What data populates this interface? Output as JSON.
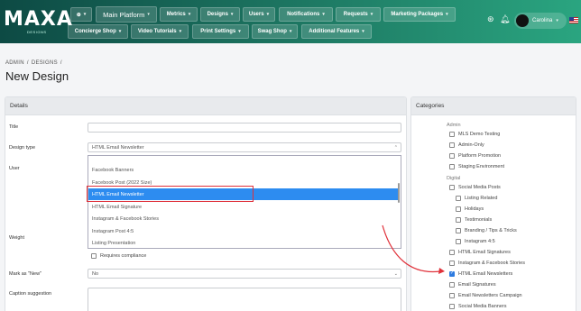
{
  "logo": {
    "text": "MAXA",
    "sub": "DESIGNS"
  },
  "nav_row1": [
    "Main Platform",
    "Metrics",
    "Designs",
    "Users",
    "Notifications",
    "Requests",
    "Marketing Packages"
  ],
  "nav_row2": [
    "Concierge Shop",
    "Video Tutorials",
    "Print Settings",
    "Swag Shop",
    "Additional Features"
  ],
  "user": {
    "name": "Carolina"
  },
  "breadcrumb": [
    "ADMIN",
    "/",
    "DESIGNS",
    "/"
  ],
  "page_title": "New Design",
  "details": {
    "heading": "Details",
    "labels": {
      "title": "Title",
      "design_type": "Design type",
      "user": "User",
      "weight": "Weight",
      "mark_new": "Mark as \"New\"",
      "caption": "Caption suggestion"
    },
    "design_type_value": "HTML Email Newsletter",
    "dropdown_options": [
      "Facebook Banners",
      "Facebook Post (2022 Size)",
      "HTML Email Newsletter",
      "HTML Email Signature",
      "Instagram & Facebook Stories",
      "Instagram Post 4:5",
      "Listing Presentation"
    ],
    "selected_option_index": 2,
    "requires_compliance": "Requires compliance",
    "mark_new_value": "No"
  },
  "categories": {
    "heading": "Categories",
    "group_admin": "Admin",
    "admin_items": [
      "MLS Demo Testing",
      "Admin-Only",
      "Platform Promotion",
      "Staging Environment"
    ],
    "group_digital": "Digital",
    "social_media_posts": "Social Media Posts",
    "social_sub": [
      "Listing Related",
      "Holidays",
      "Testimonials",
      "Branding / Tips & Tricks",
      "Instagram 4:5"
    ],
    "digital_items": [
      "HTML Email Signatures",
      "Instagram & Facebook Stories",
      "HTML Email Newsletters",
      "Email Signatures",
      "Email Newsletters Campaign",
      "Social Media Banners"
    ],
    "checked_item": "HTML Email Newsletters"
  },
  "colors": {
    "accent": "#2d8cf0",
    "annotation": "#e0313a",
    "nav_dark": "#0d4a44",
    "nav_light": "#2aa580"
  }
}
